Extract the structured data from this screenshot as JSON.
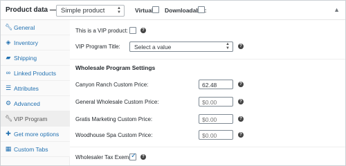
{
  "header": {
    "title": "Product data",
    "dash": "—",
    "product_type": "Simple product",
    "virtual_label": "Virtual:",
    "downloadable_label": "Downloadable:"
  },
  "sidebar": {
    "items": [
      {
        "label": "General",
        "icon": "wrench-icon"
      },
      {
        "label": "Inventory",
        "icon": "tag-icon"
      },
      {
        "label": "Shipping",
        "icon": "truck-icon"
      },
      {
        "label": "Linked Products",
        "icon": "link-icon"
      },
      {
        "label": "Attributes",
        "icon": "list-icon"
      },
      {
        "label": "Advanced",
        "icon": "gear-icon"
      },
      {
        "label": "VIP Program",
        "icon": "wrench-icon",
        "active": true
      },
      {
        "label": "Get more options",
        "icon": "plug-icon"
      },
      {
        "label": "Custom Tabs",
        "icon": "table-icon"
      }
    ]
  },
  "main": {
    "vip_product_label": "This is a VIP product:",
    "vip_title_label": "VIP Program Title:",
    "vip_title_value": "Select a value",
    "wholesale_section_title": "Wholesale Program Settings",
    "prices": [
      {
        "label": "Canyon Ranch Custom Price:",
        "value": "62.48",
        "placeholder": ""
      },
      {
        "label": "General Wholesale Custom Price:",
        "value": "",
        "placeholder": "$0.00"
      },
      {
        "label": "Gratis Marketing Custom Price:",
        "value": "",
        "placeholder": "$0.00"
      },
      {
        "label": "Woodhouse Spa Custom Price:",
        "value": "",
        "placeholder": "$0.00"
      }
    ],
    "tax_exempt_label": "Wholesaler Tax Exempt:",
    "tax_exempt_checked": true
  },
  "colors": {
    "link": "#2271b1",
    "active_tab_bg": "#eeeeee",
    "border": "#ccd0d4"
  }
}
